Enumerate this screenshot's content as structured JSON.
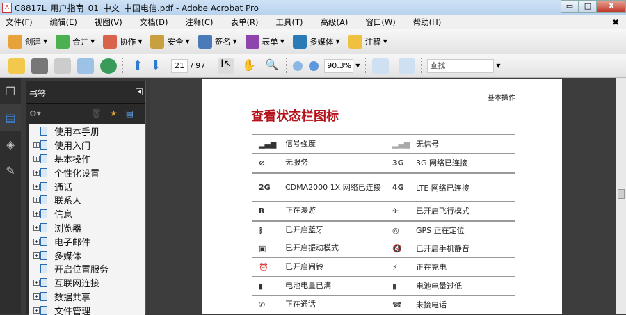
{
  "window": {
    "title": "C8817L_用户指南_01_中文_中国电信.pdf - Adobe Acrobat Pro",
    "min": "▭",
    "max": "□",
    "close": "X"
  },
  "menu": [
    "文件(F)",
    "编辑(E)",
    "视图(V)",
    "文档(D)",
    "注释(C)",
    "表单(R)",
    "工具(T)",
    "高级(A)",
    "窗口(W)",
    "帮助(H)"
  ],
  "menu_close": "✖",
  "toolbar1": [
    {
      "label": "创建",
      "color": "#e8a23a"
    },
    {
      "label": "合并",
      "color": "#4caf50"
    },
    {
      "label": "协作",
      "color": "#d9634a"
    },
    {
      "label": "安全",
      "color": "#c8a040"
    },
    {
      "label": "签名",
      "color": "#4a7ab8"
    },
    {
      "label": "表单",
      "color": "#8e44ad"
    },
    {
      "label": "多媒体",
      "color": "#2a7ab8"
    },
    {
      "label": "注释",
      "color": "#f0c040"
    }
  ],
  "toolbar2": {
    "page": "21",
    "total": "/ 97",
    "zoom": "90.3%",
    "find": "查找"
  },
  "bookmarks": {
    "title": "书签",
    "items": [
      {
        "label": "使用本手册",
        "exp": false
      },
      {
        "label": "使用入门",
        "exp": true
      },
      {
        "label": "基本操作",
        "exp": true
      },
      {
        "label": "个性化设置",
        "exp": true
      },
      {
        "label": "通话",
        "exp": true
      },
      {
        "label": "联系人",
        "exp": true
      },
      {
        "label": "信息",
        "exp": true
      },
      {
        "label": "浏览器",
        "exp": true
      },
      {
        "label": "电子邮件",
        "exp": true
      },
      {
        "label": "多媒体",
        "exp": true
      },
      {
        "label": "开启位置服务",
        "exp": false
      },
      {
        "label": "互联网连接",
        "exp": true
      },
      {
        "label": "数据共享",
        "exp": true
      },
      {
        "label": "文件管理",
        "exp": true
      }
    ]
  },
  "page": {
    "section": "基本操作",
    "title": "查看状态栏图标",
    "rows": [
      {
        "i1": "▂▄▆",
        "t1": "信号强度",
        "i2": "▂▄▆",
        "t2": "无信号",
        "thick": false
      },
      {
        "i1": "⊘",
        "t1": "无服务",
        "i2": "3G",
        "t2": "3G 网络已连接",
        "thick": false
      },
      {
        "i1": "2G",
        "t1": "CDMA2000 1X 网络已连接",
        "i2": "4G",
        "t2": "LTE 网络已连接",
        "thick": true
      },
      {
        "i1": "R",
        "t1": "正在漫游",
        "i2": "✈",
        "t2": "已开启飞行模式",
        "thick": false
      },
      {
        "i1": "ᛒ",
        "t1": "已开启蓝牙",
        "i2": "◎",
        "t2": "GPS 正在定位",
        "thick": true
      },
      {
        "i1": "▣",
        "t1": "已开启振动模式",
        "i2": "🔇",
        "t2": "已开启手机静音",
        "thick": false
      },
      {
        "i1": "⏰",
        "t1": "已开启闹铃",
        "i2": "⚡",
        "t2": "正在充电",
        "thick": false
      },
      {
        "i1": "▮",
        "t1": "电池电量已满",
        "i2": "▮",
        "t2": "电池电量过低",
        "thick": false
      },
      {
        "i1": "✆",
        "t1": "正在通话",
        "i2": "☎",
        "t2": "未接电话",
        "thick": false
      }
    ]
  }
}
